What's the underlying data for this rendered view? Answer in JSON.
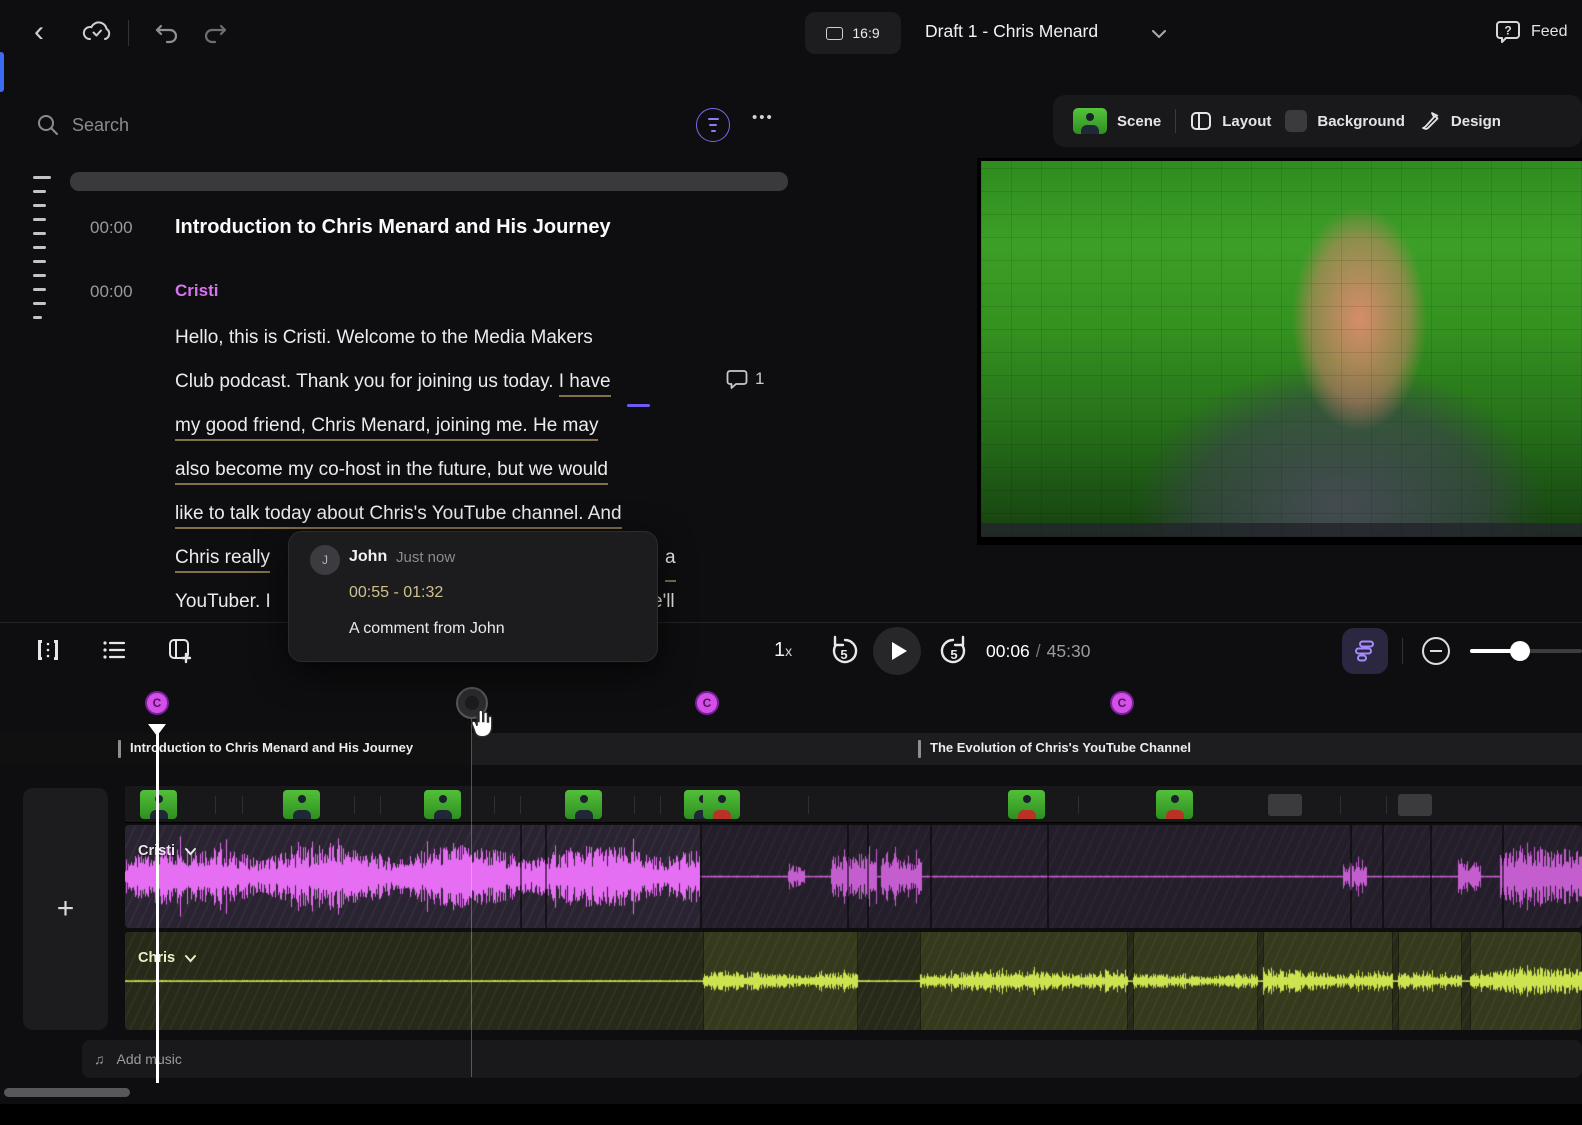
{
  "header": {
    "aspect_ratio": "16:9",
    "project_title": "Draft 1 - Chris Menard",
    "feedback_label": "Feed"
  },
  "search": {
    "placeholder": "Search"
  },
  "script": {
    "chapter_time": "00:00",
    "chapter_title": "Introduction to Chris Menard and His Journey",
    "speaker_time": "00:00",
    "speaker_name": "Cristi",
    "lines": [
      {
        "text": "Hello, this is Cristi. Welcome to the Media Makers"
      },
      {
        "pre": "Club podcast. Thank you for joining us today. ",
        "marked": "I have"
      },
      {
        "text": "my good friend, Chris Menard, joining me. He may"
      },
      {
        "text": "also become my co-host in the future, but we would"
      },
      {
        "text": "like to talk today about Chris's YouTube channel. And"
      },
      {
        "left": "Chris really",
        "right": "a"
      },
      {
        "left": "YouTuber.  I",
        "right": "e'll"
      }
    ],
    "comment_count": "1"
  },
  "comment_popup": {
    "initial": "J",
    "author": "John",
    "time_ago": "Just now",
    "range": "00:55 - 01:32",
    "body": "A comment from John"
  },
  "preview_tabs": {
    "scene": "Scene",
    "layout": "Layout",
    "background": "Background",
    "design": "Design"
  },
  "playback": {
    "speed_value": "1",
    "speed_unit": "x",
    "skip_back_amount": "5",
    "skip_forward_amount": "5",
    "current_time": "00:06",
    "separator": "/",
    "total_time": "45:30"
  },
  "timeline": {
    "marker_label": "C",
    "sections": [
      {
        "title": "Introduction to Chris Menard and His Journey"
      },
      {
        "title": "The Evolution of Chris's YouTube Channel"
      }
    ],
    "tracks": [
      {
        "name": "Cristi"
      },
      {
        "name": "Chris"
      }
    ],
    "add_music_label": "Add music"
  },
  "icons": {
    "more": "•••",
    "plus": "+",
    "music_note": "♫",
    "back": "‹"
  },
  "colors": {
    "accent_magenta": "#d44fe8",
    "accent_purple": "#8f7cf0",
    "waveform_pink": "#e66ef2",
    "waveform_green": "#cde34f",
    "comment_underline": "#837147"
  }
}
